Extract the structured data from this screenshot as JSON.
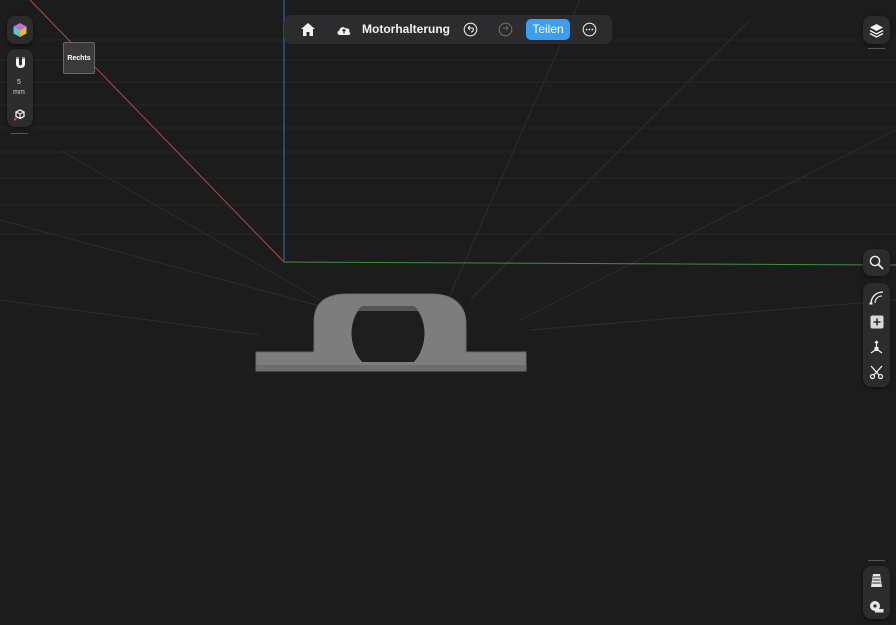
{
  "app": {
    "document_title": "Motorhalterung"
  },
  "toolbar": {
    "home_icon": "house-icon",
    "cloud_icon": "cloud-sync-icon",
    "undo_icon": "undo-icon",
    "redo_icon": "redo-icon",
    "share_label": "Teilen",
    "more_icon": "ellipsis-icon"
  },
  "left_tools": {
    "app_logo_icon": "colored-cube-icon",
    "snap_icon": "magnet-icon",
    "snap_value": "5",
    "snap_unit": "mm",
    "transform_gizmo_icon": "axes-gizmo-icon"
  },
  "view_cube": {
    "face_label": "Rechts"
  },
  "right_tools": {
    "layers_icon": "layers-icon",
    "search_icon": "search-icon",
    "sketch_icon": "arc-sketch-icon",
    "add_icon": "plus-square-icon",
    "move_icon": "move-axes-icon",
    "cut_icon": "scissors-icon",
    "render_icon": "stack-render-icon",
    "measure_icon": "tape-measure-icon"
  },
  "colors": {
    "background": "#1c1c1c",
    "panel": "#2c2c2e",
    "accent": "#3d9df0",
    "axis_x": "#b34a46",
    "axis_y": "#3d8f3a",
    "axis_z": "#3a6fc4",
    "model": "#7d7d7d"
  }
}
